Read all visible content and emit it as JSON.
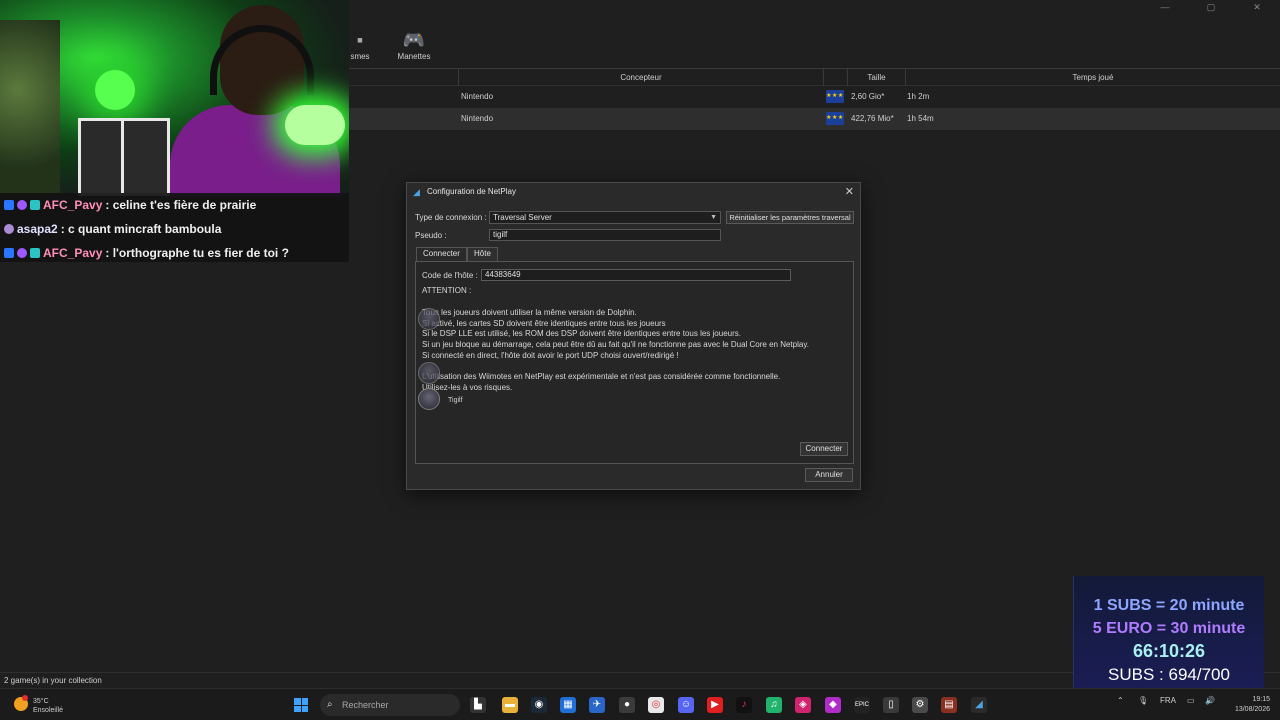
{
  "toolbar": {
    "partial_label": "smes",
    "controllers_label": "Manettes"
  },
  "window_controls": {
    "minimize": "—",
    "maximize": "▢",
    "close": "✕"
  },
  "columns": {
    "developer": "Concepteur",
    "size": "Taille",
    "playtime": "Temps joué"
  },
  "games": [
    {
      "developer": "Nintendo",
      "region": "EU",
      "size": "2,60 Gio*",
      "playtime": "1h 2m",
      "selected": false
    },
    {
      "developer": "Nintendo",
      "region": "EU",
      "size": "422,76 Mio*",
      "playtime": "1h 54m",
      "selected": true
    }
  ],
  "status_bar": "2 game(s) in your collection",
  "chat": [
    {
      "user": "AFC_Pavy",
      "message": " : celine t'es fière de prairie"
    },
    {
      "user": "asapa2",
      "message": " : c quant mincraft bamboula"
    },
    {
      "user": "AFC_Pavy",
      "message": " : l'orthographe tu es fier de toi ?"
    }
  ],
  "dialog": {
    "title": "Configuration de NetPlay",
    "connection_type_label": "Type de connexion :",
    "connection_type_value": "Traversal Server",
    "reset_button": "Réinitialiser les paramètres traversal",
    "nickname_label": "Pseudo :",
    "nickname_value": "tigilf",
    "tab_connect": "Connecter",
    "tab_host": "Hôte",
    "host_code_label": "Code de l'hôte :",
    "host_code_value": "44383649",
    "warning_title": "ATTENTION :",
    "notes": [
      "Tous les joueurs doivent utiliser la même version de Dolphin.",
      "Si activé, les cartes SD doivent être identiques entre tous les joueurs",
      "Si le DSP LLE est utilisé, les ROM des DSP doivent être identiques entre tous les joueurs.",
      "Si un jeu bloque au démarrage, cela peut être dû au fait qu'il ne fonctionne pas avec le Dual Core en Netplay.",
      "Si connecté en direct, l'hôte doit avoir le port UDP choisi ouvert/redirigé !",
      "",
      "L'utilisation des Wiimotes en NetPlay est expérimentale et n'est pas considérée comme fonctionnelle.",
      "Utilisez-les à vos risques."
    ],
    "overlay_user": "Tigilf",
    "connect_button": "Connecter",
    "cancel_button": "Annuler"
  },
  "subathon": {
    "line1": "1 SUBS = 20 minute",
    "line2": "5 EURO = 30 minute",
    "timer": "66:10:26",
    "subs": "SUBS : 694/700"
  },
  "taskbar": {
    "temperature": "35°C",
    "weather": "Ensoleillé",
    "search_placeholder": "Rechercher",
    "language": "FRA",
    "time": "19:15",
    "date": "13/08/2026"
  },
  "colors": {
    "accent": "#3ea2ff",
    "chat_user": "#ff8fb8",
    "eu_flag": "#1c3f9c"
  }
}
